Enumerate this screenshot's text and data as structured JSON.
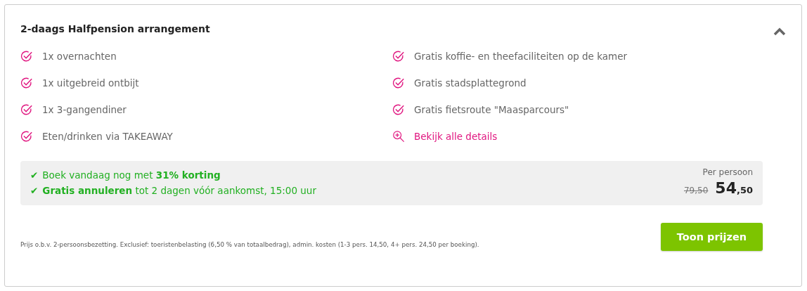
{
  "title": "2-daags Halfpension arrangement",
  "collapse": {
    "expanded": true
  },
  "columns": [
    [
      {
        "kind": "check",
        "text": "1x overnachten"
      },
      {
        "kind": "check",
        "text": "1x uitgebreid ontbijt"
      },
      {
        "kind": "check",
        "text": "1x 3-gangendiner"
      },
      {
        "kind": "check",
        "text": "Eten/drinken via TAKEAWAY"
      }
    ],
    [
      {
        "kind": "check",
        "text": "Gratis koffie- en theefaciliteiten op de kamer"
      },
      {
        "kind": "check",
        "text": "Gratis stadsplattegrond"
      },
      {
        "kind": "check",
        "text": "Gratis fietsroute \"Maasparcours\""
      },
      {
        "kind": "details",
        "text": "Bekijk alle details"
      }
    ]
  ],
  "benefits": [
    {
      "mark": "✔",
      "text": "Boek vandaag nog met **31% korting**"
    },
    {
      "mark": "✔",
      "text": "**Gratis annuleren** tot 2 dagen vóór aankomst, 15:00 uur"
    }
  ],
  "price": {
    "label": "Per persoon",
    "old": "79,50",
    "whole": "54",
    "cents": ",50"
  },
  "footnote": "Prijs o.b.v. 2-persoonsbezetting. Exclusief: toeristenbelasting (6,50 % van totaalbedrag), admin. kosten (1-3 pers. 14,50, 4+ pers. 24,50 per boeking).",
  "button": "Toon prijzen"
}
